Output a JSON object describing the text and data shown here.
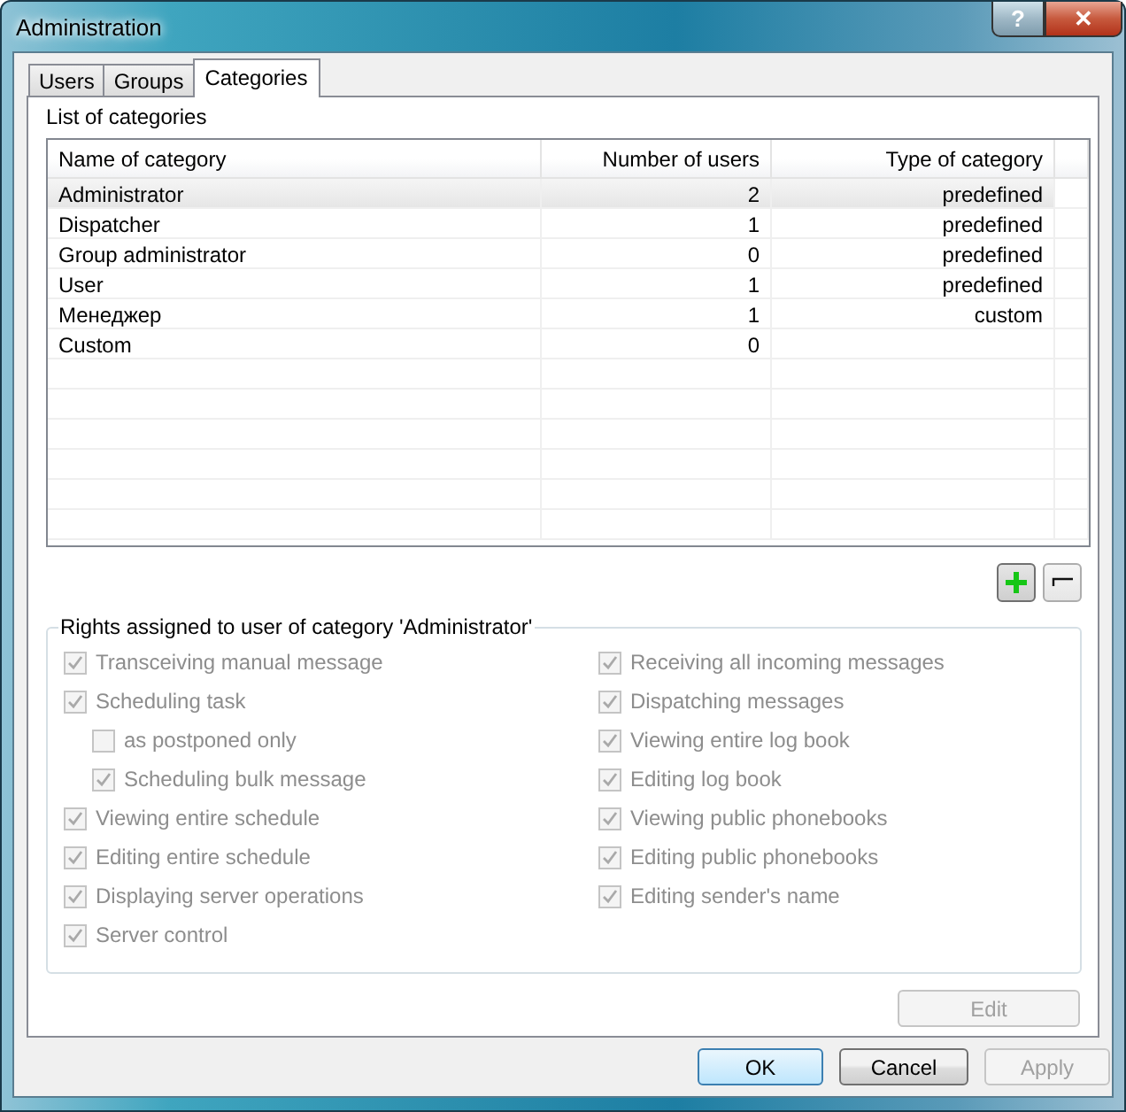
{
  "window": {
    "title": "Administration",
    "buttons": [
      "?",
      "✕"
    ]
  },
  "tabs": [
    {
      "label": "Users",
      "selected": false
    },
    {
      "label": "Groups",
      "selected": false
    },
    {
      "label": "Categories",
      "selected": true
    }
  ],
  "categories": {
    "title": "List of categories",
    "columns": [
      "Name of category",
      "Number of users",
      "Type of category"
    ],
    "rows": [
      {
        "name": "Administrator",
        "users": "2",
        "type": "predefined",
        "selected": true
      },
      {
        "name": "Dispatcher",
        "users": "1",
        "type": "predefined",
        "selected": false
      },
      {
        "name": "Group administrator",
        "users": "0",
        "type": "predefined",
        "selected": false
      },
      {
        "name": "User",
        "users": "1",
        "type": "predefined",
        "selected": false
      },
      {
        "name": "Менеджер",
        "users": "1",
        "type": "custom",
        "selected": false
      },
      {
        "name": "Custom",
        "users": "0",
        "selected": false
      }
    ]
  },
  "rights": {
    "title": "Rights assigned to user of category 'Administrator'",
    "left": [
      {
        "label": "Transceiving manual message",
        "checked": true,
        "disabled": true
      },
      {
        "label": "Scheduling task",
        "checked": true,
        "disabled": true,
        "children": [
          {
            "label": "as postponed only",
            "checked": false,
            "disabled": true
          },
          {
            "label": "Scheduling bulk message",
            "checked": true,
            "disabled": true
          }
        ]
      },
      {
        "label": "Viewing entire schedule",
        "checked": true,
        "disabled": true
      },
      {
        "label": "Editing entire schedule",
        "checked": true,
        "disabled": true
      },
      {
        "label": "Displaying server operations",
        "checked": true,
        "disabled": true
      },
      {
        "label": "Server control",
        "checked": true,
        "disabled": true
      }
    ],
    "right": [
      {
        "label": "Receiving all incoming messages",
        "checked": true,
        "disabled": true
      },
      {
        "label": "Dispatching messages",
        "checked": true,
        "disabled": true
      },
      {
        "label": "Viewing entire log book",
        "checked": true,
        "disabled": true
      },
      {
        "label": "Editing log book",
        "checked": true,
        "disabled": true
      },
      {
        "label": "Viewing public phonebooks",
        "checked": true,
        "disabled": true
      },
      {
        "label": "Editing public phonebooks",
        "checked": true,
        "disabled": true
      },
      {
        "label": "Editing sender's name",
        "checked": true,
        "disabled": true
      }
    ],
    "edit_button": {
      "label": "Edit",
      "disabled": true
    }
  },
  "buttons": [
    {
      "label": "OK",
      "disabled": false,
      "default": true
    },
    {
      "label": "Cancel",
      "disabled": false,
      "default": false
    },
    {
      "label": "Apply",
      "disabled": true,
      "default": false
    }
  ]
}
